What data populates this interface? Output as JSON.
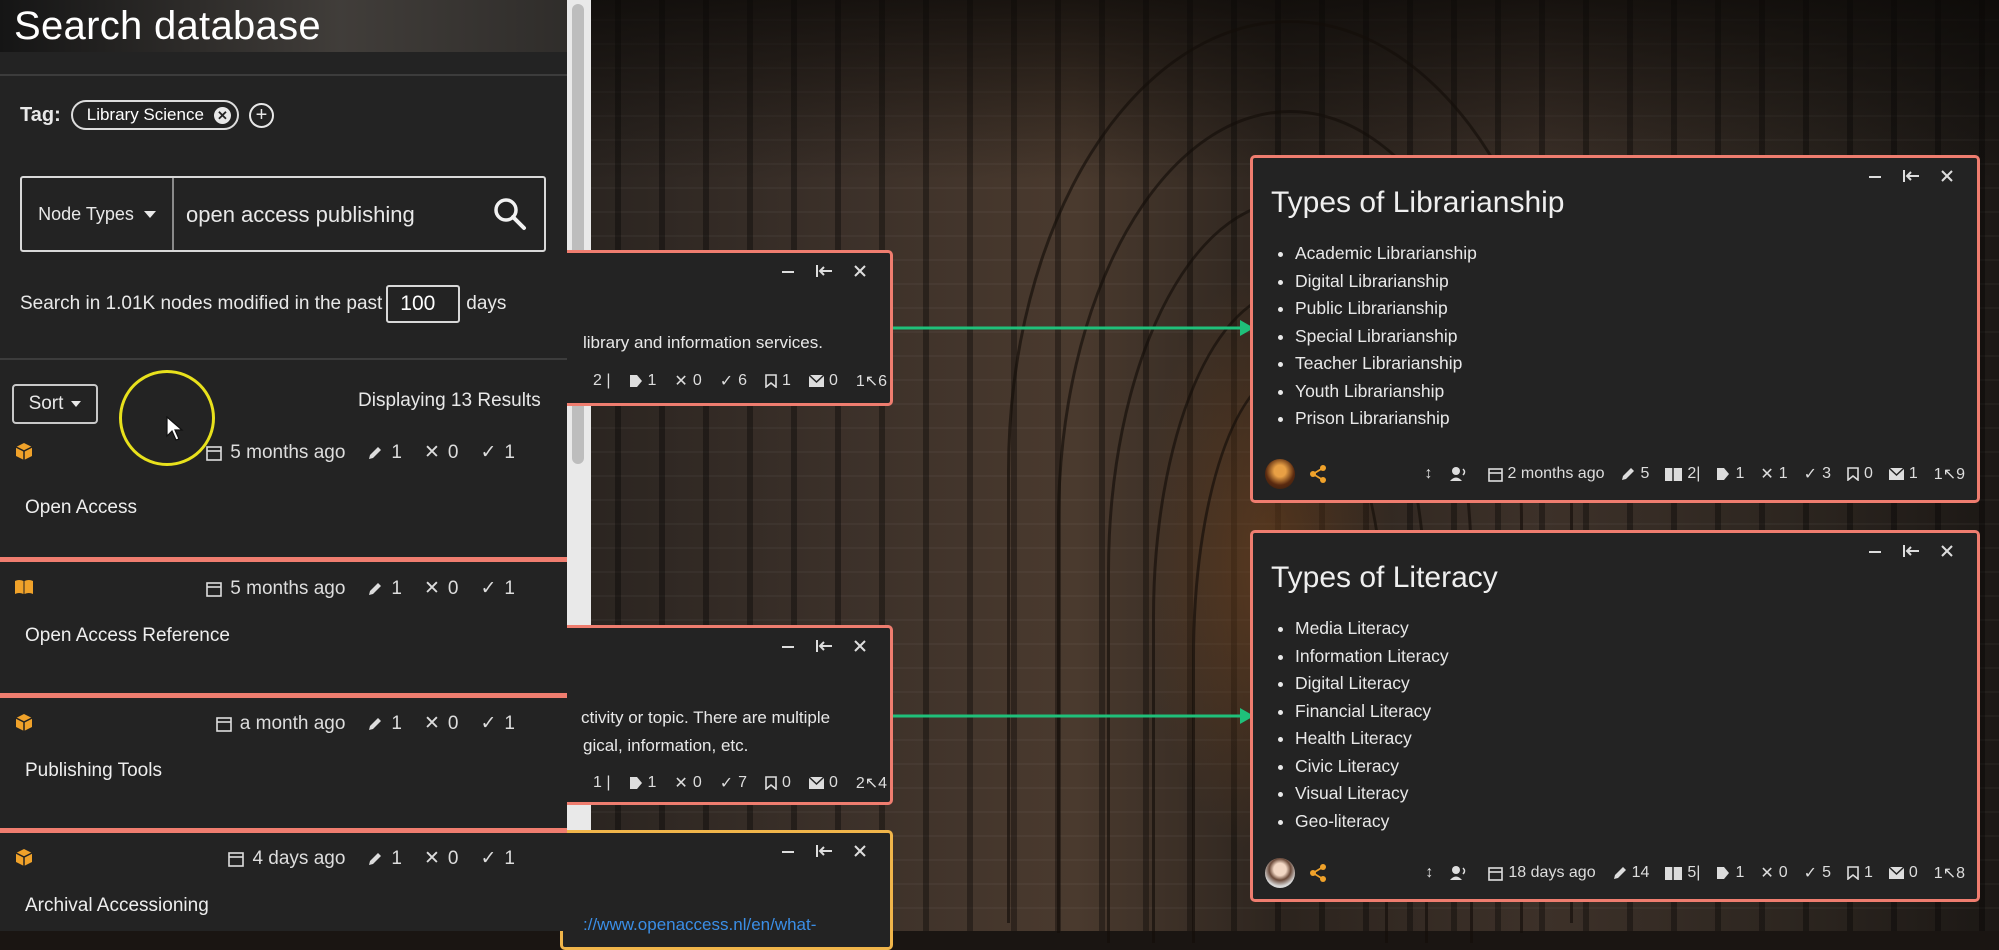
{
  "sidebar": {
    "title": "Search database",
    "tag_label": "Tag:",
    "tag_chip": "Library Science",
    "node_types_label": "Node Types",
    "search_value": "open access publishing",
    "days_prefix": "Search in 1.01K nodes modified in the past",
    "days_value": "100",
    "days_suffix": "days",
    "sort_label": "Sort",
    "result_count": "Displaying 13 Results",
    "results": [
      {
        "title": "Open Access",
        "modified": "5 months ago",
        "edits": "1",
        "x": "0",
        "checks": "1",
        "icon": "box-icon"
      },
      {
        "title": "Open Access Reference",
        "modified": "5 months ago",
        "edits": "1",
        "x": "0",
        "checks": "1",
        "icon": "book-icon"
      },
      {
        "title": "Publishing Tools",
        "modified": "a month ago",
        "edits": "1",
        "x": "0",
        "checks": "1",
        "icon": "box-icon"
      },
      {
        "title": "Archival Accessioning",
        "modified": "4 days ago",
        "edits": "1",
        "x": "0",
        "checks": "1",
        "icon": "box-icon"
      }
    ]
  },
  "cards": {
    "librarianship": {
      "title": "Types of Librarianship",
      "items": [
        "Academic Librarianship",
        "Digital Librarianship",
        "Public Librarianship",
        "Special Librarianship",
        "Teacher Librarianship",
        "Youth Librarianship",
        "Prison Librarianship"
      ],
      "modified": "2 months ago",
      "edits": "5",
      "children": "2",
      "tags": "1",
      "x": "1",
      "checks": "3",
      "bookmarks": "0",
      "messages": "1",
      "links": "1↖9"
    },
    "literacy": {
      "title": "Types of Literacy",
      "items": [
        "Media Literacy",
        "Information Literacy",
        "Digital Literacy",
        "Financial Literacy",
        "Health Literacy",
        "Civic Literacy",
        "Visual Literacy",
        "Geo-literacy"
      ],
      "modified": "18 days ago",
      "edits": "14",
      "children": "5",
      "tags": "1",
      "x": "0",
      "checks": "5",
      "bookmarks": "1",
      "messages": "0",
      "links": "1↖8"
    },
    "partial_top": {
      "text": "library and information services.",
      "children": "2 |",
      "tags": "1",
      "x": "0",
      "checks": "6",
      "bookmarks": "1",
      "messages": "0",
      "links": "1↖6"
    },
    "partial_mid": {
      "text_line1": "ctivity or topic. There are multiple",
      "text_line2": "gical, information, etc.",
      "children": "1 |",
      "tags": "1",
      "x": "0",
      "checks": "7",
      "bookmarks": "0",
      "messages": "0",
      "links": "2↖4"
    },
    "partial_bottom": {
      "link_text": "://www.openaccess.nl/en/what-"
    }
  },
  "colors": {
    "card_border": "#ef7d6f",
    "card_border_alt": "#f0b54a",
    "connector": "#1fc07a",
    "cursor_ring": "#e8e11c",
    "node_icon": "#f0a22a"
  }
}
